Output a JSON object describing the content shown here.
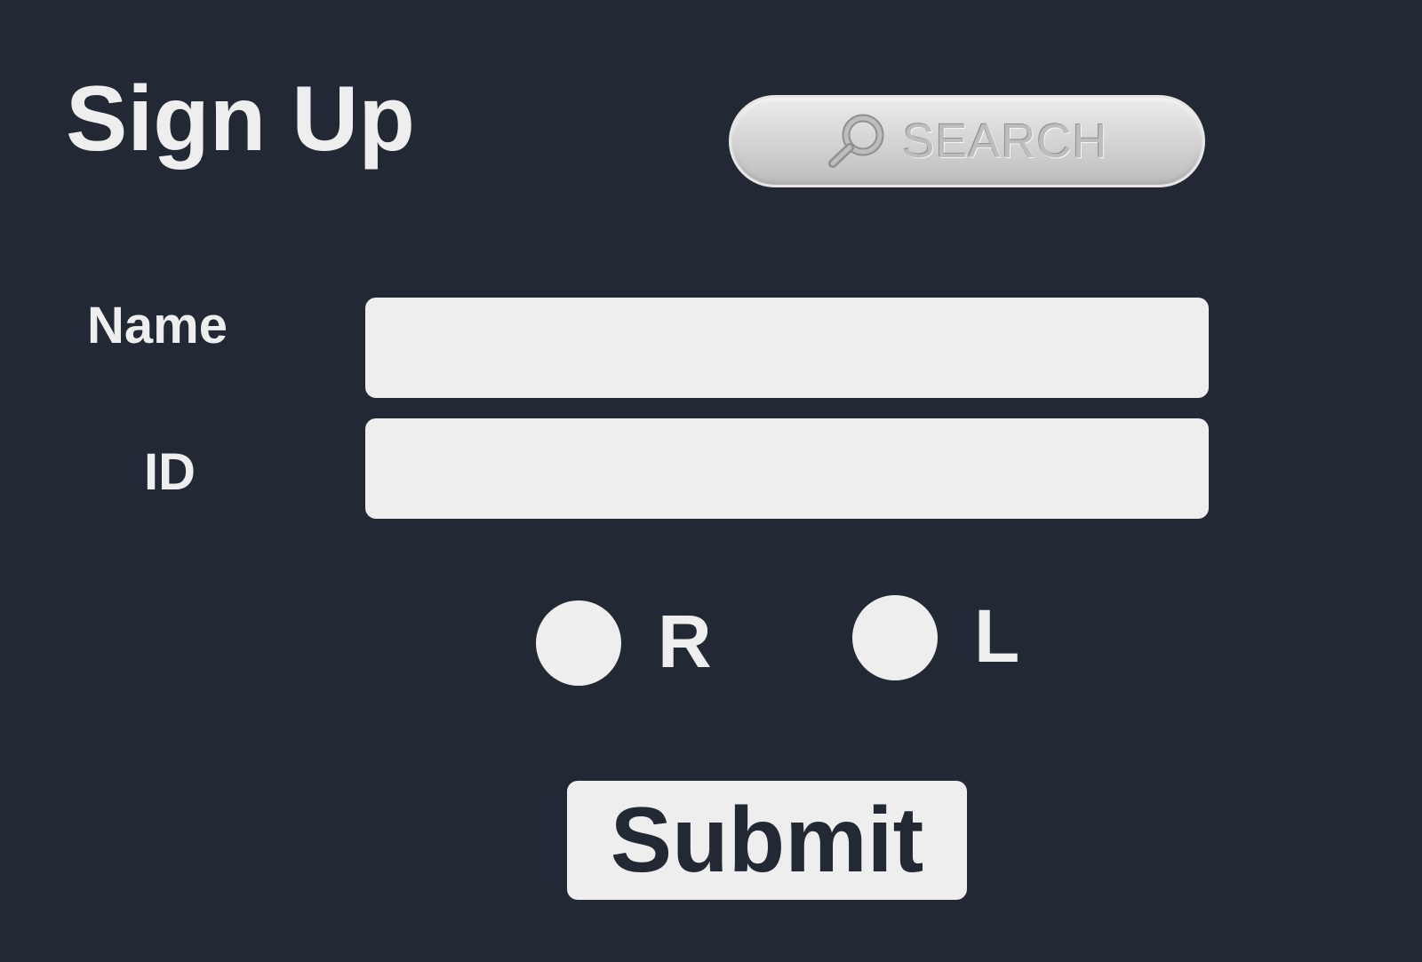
{
  "header": {
    "title": "Sign Up"
  },
  "search": {
    "label": "SEARCH",
    "icon": "magnifier-icon"
  },
  "form": {
    "name_label": "Name",
    "name_value": "",
    "id_label": "ID",
    "id_value": "",
    "options": [
      {
        "label": "R",
        "selected": false
      },
      {
        "label": "L",
        "selected": false
      }
    ],
    "submit_label": "Submit"
  },
  "colors": {
    "background": "#222834",
    "foreground": "#eeeeee",
    "search_button": "#d2d2d2"
  }
}
